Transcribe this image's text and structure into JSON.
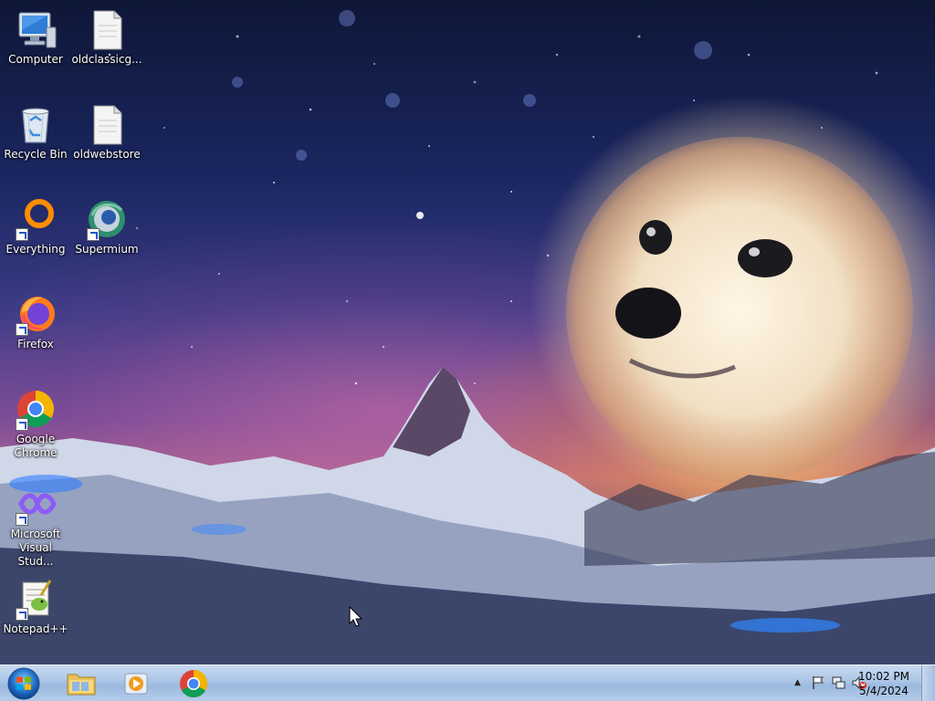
{
  "desktop": {
    "icons": [
      {
        "label": "Computer",
        "icon": "computer-icon"
      },
      {
        "label": "oldclassicg...",
        "icon": "file-icon"
      },
      {
        "label": "Recycle Bin",
        "icon": "recycle-bin-icon"
      },
      {
        "label": "oldwebstore",
        "icon": "file-icon"
      },
      {
        "label": "Everything",
        "icon": "everything-icon"
      },
      {
        "label": "Supermium",
        "icon": "supermium-icon"
      },
      {
        "label": "Firefox",
        "icon": "firefox-icon"
      },
      {
        "label": "Google Chrome",
        "icon": "chrome-icon"
      },
      {
        "label": "Microsoft Visual Stud...",
        "icon": "visual-studio-icon"
      },
      {
        "label": "Notepad++",
        "icon": "notepadpp-icon"
      }
    ]
  },
  "taskbar": {
    "start_icon": "windows-start-icon",
    "pinned": [
      {
        "name": "file-explorer",
        "icon": "folder-icon"
      },
      {
        "name": "media-player",
        "icon": "media-player-icon"
      },
      {
        "name": "chrome",
        "icon": "chrome-icon"
      }
    ],
    "tray": {
      "clock_time": "10:02 PM",
      "clock_date": "5/4/2024"
    }
  },
  "colors": {
    "taskbar_top": "#c9daf0",
    "taskbar_bottom": "#9bb9df",
    "chrome_red": "#db4437",
    "chrome_green": "#0f9d58",
    "chrome_yellow": "#f4b400",
    "chrome_blue": "#4285f4"
  }
}
